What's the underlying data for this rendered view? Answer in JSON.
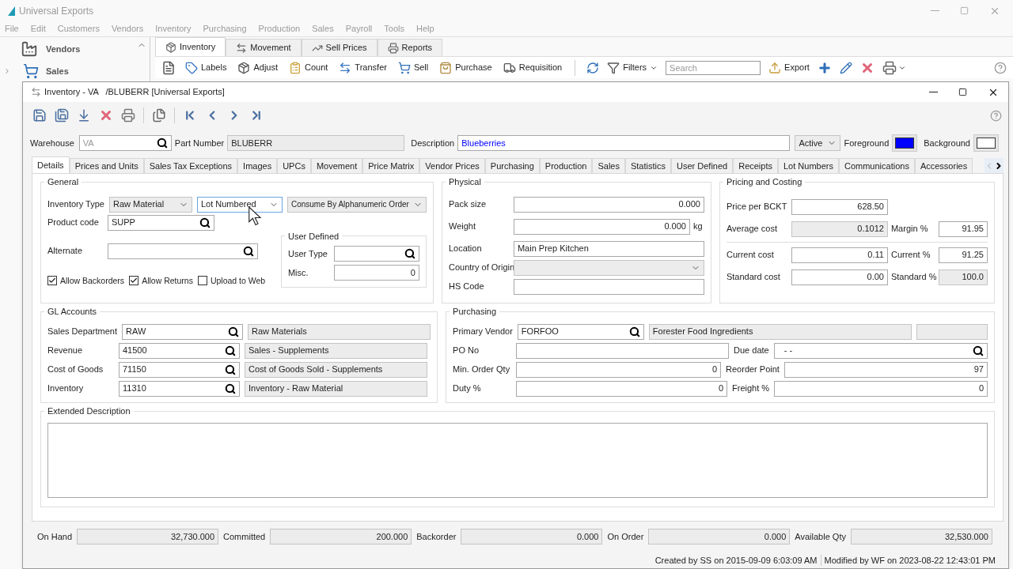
{
  "app": {
    "title": "Universal Exports"
  },
  "menu": [
    "File",
    "Edit",
    "Customers",
    "Vendors",
    "Inventory",
    "Purchasing",
    "Production",
    "Sales",
    "Payroll",
    "Tools",
    "Help"
  ],
  "sidebar": {
    "items": [
      {
        "label": "Vendors"
      },
      {
        "label": "Sales"
      }
    ]
  },
  "module_tabs": [
    {
      "label": "Inventory",
      "selected": true
    },
    {
      "label": "Movement",
      "selected": false
    },
    {
      "label": "Sell Prices",
      "selected": false
    },
    {
      "label": "Reports",
      "selected": false
    }
  ],
  "toolbar": {
    "buttons": [
      "Labels",
      "Adjust",
      "Count",
      "Transfer",
      "Sell",
      "Purchase",
      "Requisition"
    ],
    "filters": "Filters",
    "search": {
      "placeholder": "Search"
    },
    "export": "Export"
  },
  "window": {
    "title": "Inventory - VA   /BLUBERR [Universal Exports]",
    "header": {
      "warehouse": {
        "label": "Warehouse",
        "value": "VA",
        "disabled": true
      },
      "part_number": {
        "label": "Part Number",
        "value": "BLUBERR",
        "readonly": true
      },
      "description": {
        "label": "Description",
        "value": "Blueberries"
      },
      "status": {
        "value": "Active",
        "readonly": true
      },
      "foreground": {
        "label": "Foreground",
        "color": "#0000ff"
      },
      "background": {
        "label": "Background",
        "color": "#ffffff"
      }
    },
    "tabs": [
      {
        "label": "Details",
        "selected": true
      },
      {
        "label": "Prices and Units",
        "selected": false
      },
      {
        "label": "Sales Tax Exceptions",
        "selected": false
      },
      {
        "label": "Images",
        "selected": false
      },
      {
        "label": "UPCs",
        "selected": false
      },
      {
        "label": "Movement",
        "selected": false
      },
      {
        "label": "Price Matrix",
        "selected": false
      },
      {
        "label": "Vendor Prices",
        "selected": false
      },
      {
        "label": "Purchasing",
        "selected": false
      },
      {
        "label": "Production",
        "selected": false
      },
      {
        "label": "Sales",
        "selected": false
      },
      {
        "label": "Statistics",
        "selected": false
      },
      {
        "label": "User Defined",
        "selected": false
      },
      {
        "label": "Receipts",
        "selected": false
      },
      {
        "label": "Lot Numbers",
        "selected": false
      },
      {
        "label": "Communications",
        "selected": false
      },
      {
        "label": "Accessories",
        "selected": false
      }
    ],
    "general": {
      "title": "General",
      "inventory_type": {
        "label": "Inventory Type",
        "values": [
          {
            "value": "Raw Material",
            "readonly": true
          },
          {
            "value": "Lot Numbered",
            "focused": true
          },
          {
            "value": "Consume By Alphanumeric Order",
            "readonly": true
          }
        ]
      },
      "product_code": {
        "label": "Product code",
        "value": "SUPP"
      },
      "alternate": {
        "label": "Alternate"
      },
      "user_defined": {
        "title": "User Defined",
        "user_type": {
          "label": "User Type"
        },
        "misc": {
          "label": "Misc.",
          "value": "0"
        }
      },
      "checkboxes": [
        {
          "label": "Allow Backorders",
          "checked": true
        },
        {
          "label": "Allow Returns",
          "checked": true
        },
        {
          "label": "Upload to Web",
          "checked": false
        }
      ]
    },
    "physical": {
      "title": "Physical",
      "pack_size": {
        "label": "Pack size",
        "value": "0.000"
      },
      "weight": {
        "label": "Weight",
        "value": "0.000",
        "unit": "kg"
      },
      "location": {
        "label": "Location",
        "value": "Main Prep Kitchen"
      },
      "country": {
        "label": "Country of Origin",
        "readonly": true
      },
      "hs_code": {
        "label": "HS Code"
      }
    },
    "pricing": {
      "title": "Pricing and Costing",
      "rows": [
        [
          {
            "label": "Price per BCKT",
            "value": "628.50"
          }
        ],
        [
          {
            "label": "Average cost",
            "value": "0.1012",
            "readonly": true
          },
          {
            "label": "Margin %",
            "value": "91.95"
          }
        ],
        [
          {
            "label": "Current cost",
            "value": "0.11"
          },
          {
            "label": "Current %",
            "value": "91.25"
          }
        ],
        [
          {
            "label": "Standard cost",
            "value": "0.00"
          },
          {
            "label": "Standard %",
            "value": "100.0",
            "readonly": true
          }
        ]
      ]
    },
    "gl_accounts": {
      "title": "GL Accounts",
      "rows": [
        {
          "label": "Sales Department",
          "code": "RAW",
          "name": "Raw Materials"
        },
        {
          "label": "Revenue",
          "code": "41500",
          "name": "Sales - Supplements"
        },
        {
          "label": "Cost of Goods",
          "code": "71150",
          "name": "Cost of Goods Sold - Supplements"
        },
        {
          "label": "Inventory",
          "code": "11310",
          "name": "Inventory - Raw Material"
        }
      ]
    },
    "purchasing": {
      "title": "Purchasing",
      "primary_vendor": {
        "label": "Primary Vendor",
        "code": "FORFOO",
        "name": "Forester Food Ingredients"
      },
      "po_no": {
        "label": "PO No"
      },
      "due_date": {
        "label": "Due date",
        "value": "- -"
      },
      "min_order_qty": {
        "label": "Min. Order Qty",
        "value": "0"
      },
      "reorder_point": {
        "label": "Reorder Point",
        "value": "97"
      },
      "duty": {
        "label": "Duty %",
        "value": "0"
      },
      "freight": {
        "label": "Freight %",
        "value": "0"
      }
    },
    "extended_description": {
      "title": "Extended Description"
    },
    "totals": [
      {
        "label": "On Hand",
        "value": "32,730.000",
        "readonly": true
      },
      {
        "label": "Committed",
        "value": "200.000",
        "readonly": true
      },
      {
        "label": "Backorder",
        "value": "0.000",
        "readonly": true
      },
      {
        "label": "On Order",
        "value": "0.000",
        "readonly": true
      },
      {
        "label": "Available Qty",
        "value": "32,530.000",
        "readonly": true
      }
    ],
    "status_bar": {
      "created": "Created by SS on 2015-09-09 6:03:09 AM",
      "modified": "Modified by WF on 2023-08-22 12:43:01 PM"
    }
  }
}
